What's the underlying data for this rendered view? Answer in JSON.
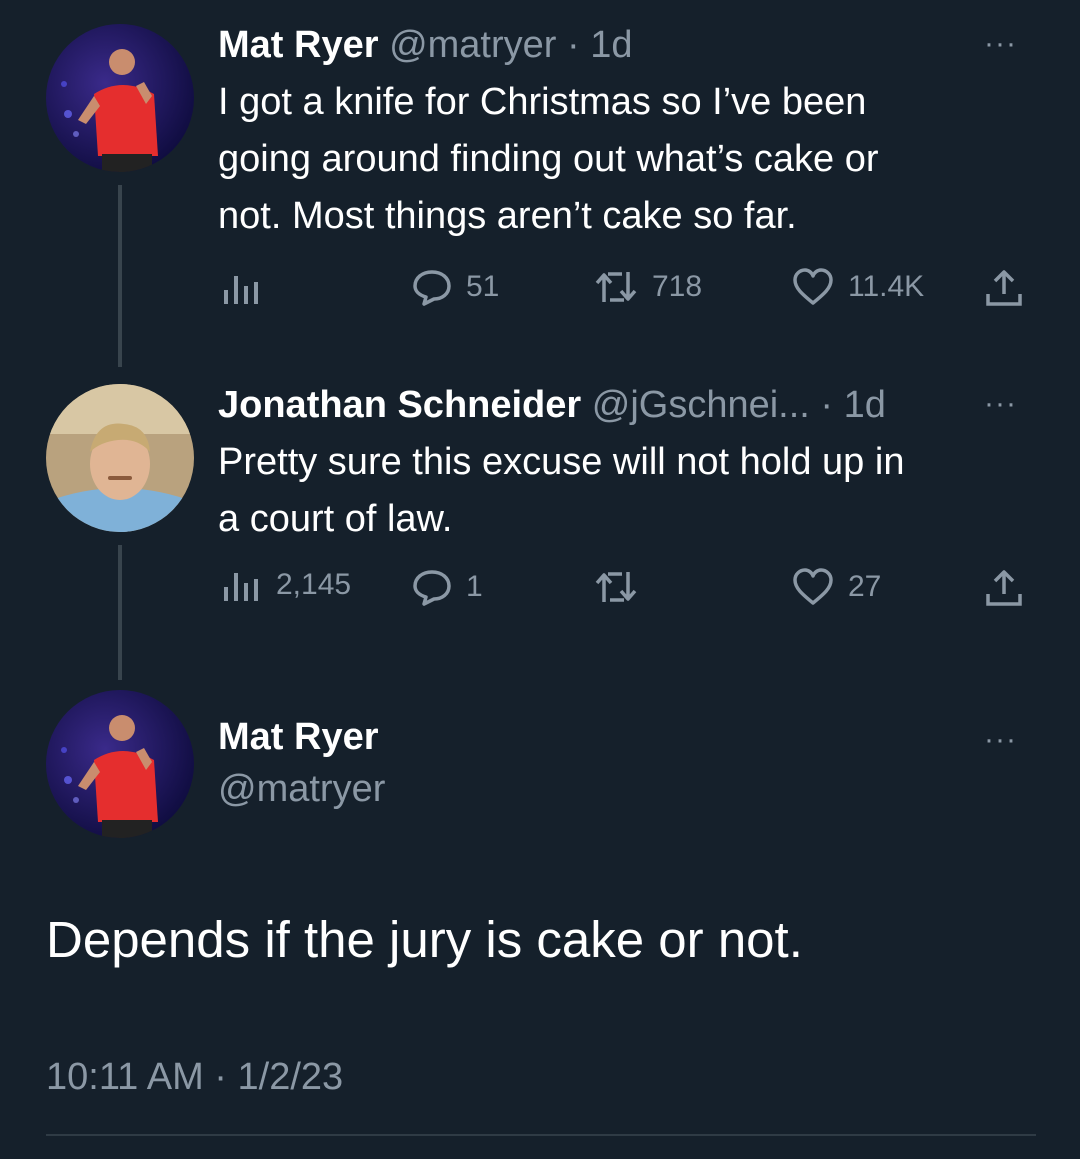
{
  "tweet1": {
    "name": "Mat Ryer",
    "handle": "@matryer",
    "time": "· 1d",
    "lines": [
      "I got a knife for Christmas so I’ve been",
      "going around finding out what’s cake or",
      "not. Most things aren’t cake so far."
    ],
    "replies": "51",
    "retweets": "718",
    "likes": "11.4K",
    "more": "···"
  },
  "tweet2": {
    "name": "Jonathan Schneider",
    "handle": "@jGschnei...",
    "time": "· 1d",
    "lines": [
      "Pretty sure this excuse will not hold up in",
      "a court of law."
    ],
    "views": "2,145",
    "replies": "1",
    "likes": "27",
    "more": "···"
  },
  "tweet3": {
    "name": "Mat Ryer",
    "handle": "@matryer",
    "text": "Depends if the jury is cake or not.",
    "timestamp": "10:11 AM · 1/2/23",
    "more": "···"
  },
  "colors": {
    "background": "#15202b",
    "secondary_text": "#8b98a5",
    "thread_line": "#38444d"
  },
  "icons": [
    "analytics-icon",
    "reply-icon",
    "retweet-icon",
    "like-icon",
    "share-icon",
    "more-icon"
  ]
}
